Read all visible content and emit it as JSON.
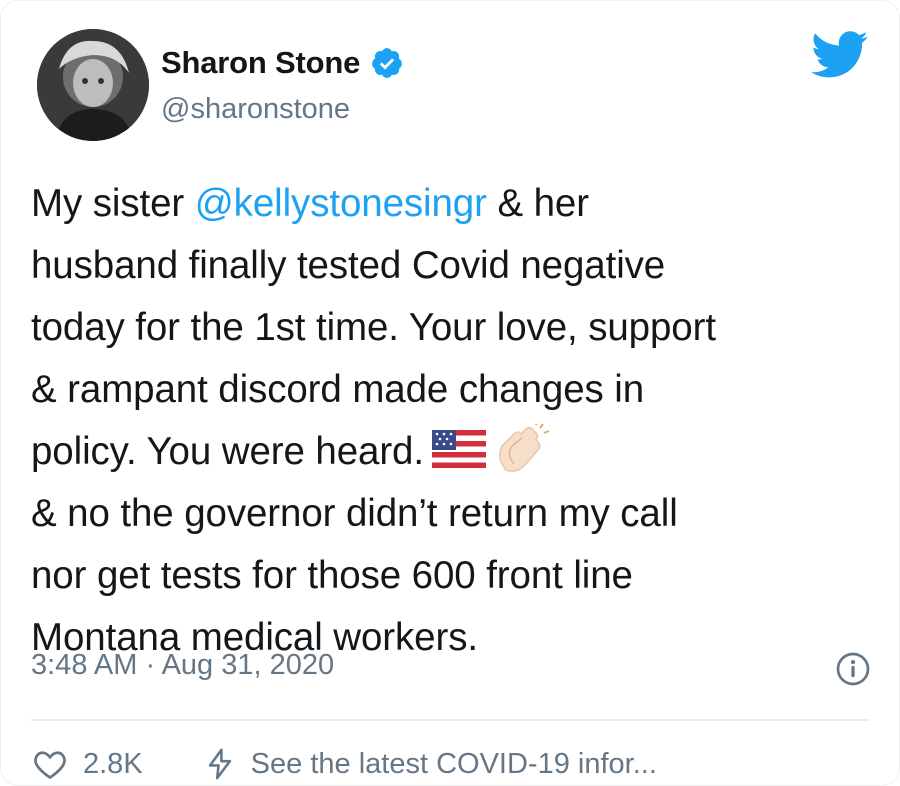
{
  "tweet": {
    "author": {
      "display_name": "Sharon Stone",
      "handle": "@sharonstone",
      "verified": true
    },
    "text_parts": {
      "before_mention": "My sister ",
      "mention": "@kellystonesingr",
      "after_mention": " & her\nhusband finally tested Covid negative\ntoday for the 1st time. Your love, support\n& rampant discord made changes in\npolicy. You were heard.",
      "after_emoji": "\n& no the governor didn’t return my call\nnor get tests for those 600 front line\nMontana medical workers."
    },
    "emojis": [
      "us-flag-emoji",
      "clapping-hands-emoji"
    ],
    "timestamp": "3:48 AM · Aug 31, 2020",
    "likes": "2.8K",
    "covid_link": "See the latest COVID-19 infor..."
  },
  "colors": {
    "accent": "#1da1f2",
    "text": "#14171a",
    "secondary": "#657786"
  },
  "icons": [
    "avatar",
    "verified-badge-icon",
    "twitter-bird-icon",
    "info-icon",
    "heart-icon",
    "lightning-icon"
  ]
}
